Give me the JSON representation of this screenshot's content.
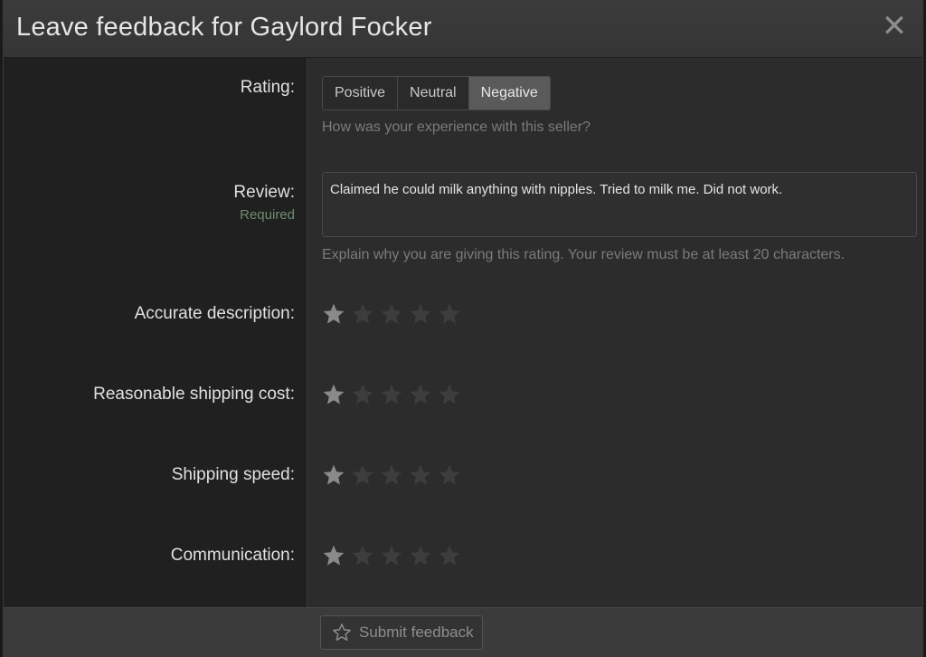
{
  "dialog": {
    "title": "Leave feedback for Gaylord Focker",
    "close_icon": "close-icon"
  },
  "rating": {
    "label": "Rating:",
    "options": [
      "Positive",
      "Neutral",
      "Negative"
    ],
    "selected": "Negative",
    "hint": "How was your experience with this seller?"
  },
  "review": {
    "label": "Review:",
    "required_label": "Required",
    "value": "Claimed he could milk anything with nipples.  Tried to milk me.  Did not work.",
    "hint": "Explain why you are giving this rating. Your review must be at least 20 characters."
  },
  "ratings": [
    {
      "label": "Accurate description:",
      "stars": 1,
      "max": 5
    },
    {
      "label": "Reasonable shipping cost:",
      "stars": 1,
      "max": 5
    },
    {
      "label": "Shipping speed:",
      "stars": 1,
      "max": 5
    },
    {
      "label": "Communication:",
      "stars": 1,
      "max": 5
    }
  ],
  "footer": {
    "submit_label": "Submit feedback",
    "submit_icon": "star-outline-icon"
  },
  "colors": {
    "star_filled": "#8a8a8a",
    "star_empty": "#3d3d3d",
    "selected_button": "#5a5a5a"
  }
}
